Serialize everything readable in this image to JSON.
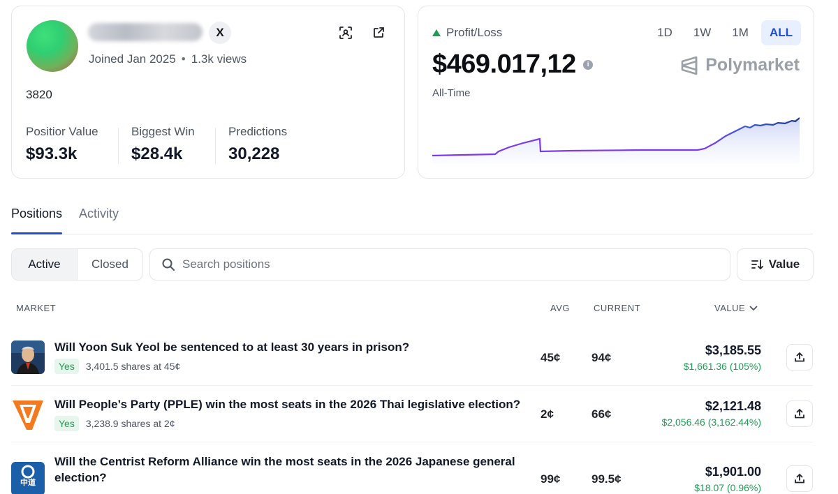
{
  "profile": {
    "joined": "Joined Jan 2025",
    "views": "1.3k views",
    "user_id": "3820",
    "stats": [
      {
        "label": "Positior Value",
        "value": "$93.3k"
      },
      {
        "label": "Biggest Win",
        "value": "$28.4k"
      },
      {
        "label": "Predictions",
        "value": "30,228"
      }
    ],
    "x_label": "X"
  },
  "pnl": {
    "label": "Profit/Loss",
    "value": "$469.017,12",
    "period": "All-Time",
    "ranges": [
      "1D",
      "1W",
      "1M",
      "ALL"
    ],
    "active_range": "ALL",
    "brand": "Polymarket",
    "accent_color": "#1d4ed8",
    "up_color": "#1f9d55"
  },
  "tabs": [
    "Positions",
    "Activity"
  ],
  "filters": {
    "active": "Active",
    "closed": "Closed"
  },
  "search": {
    "placeholder": "Search positions"
  },
  "sort": {
    "label": "Value"
  },
  "table": {
    "headers": {
      "market": "MARKET",
      "avg": "AVG",
      "current": "CURRENT",
      "value": "VALUE"
    },
    "rows": [
      {
        "title": "Will Yoon Suk Yeol be sentenced to at least 30 years in prison?",
        "outcome": "Yes",
        "shares": "3,401.5 shares at 45¢",
        "avg": "45¢",
        "current": "94¢",
        "value": "$3,185.55",
        "pnl": "$1,661.36 (105%)"
      },
      {
        "title": "Will People’s Party (PPLE) win the most seats in the 2026 Thai legislative election?",
        "outcome": "Yes",
        "shares": "3,238.9 shares at 2¢",
        "avg": "2¢",
        "current": "66¢",
        "value": "$2,121.48",
        "pnl": "$2,056.46 (3,162.44%)"
      },
      {
        "title_line1": "Will the Centrist Reform Alliance win the most seats in the 2026 Japanese general",
        "title_line2": "election?",
        "avg": "99¢",
        "current": "99.5¢",
        "value": "$1,901.00",
        "pnl": "$18.07 (0.96%)",
        "thumb_text": "中道"
      }
    ]
  }
}
